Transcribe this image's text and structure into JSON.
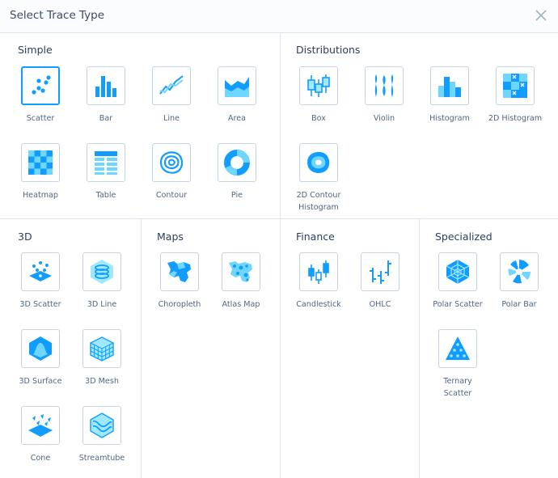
{
  "header": {
    "title": "Select Trace Type"
  },
  "sections": {
    "simple": {
      "title": "Simple",
      "items": [
        {
          "label": "Scatter"
        },
        {
          "label": "Bar"
        },
        {
          "label": "Line"
        },
        {
          "label": "Area"
        },
        {
          "label": "Heatmap"
        },
        {
          "label": "Table"
        },
        {
          "label": "Contour"
        },
        {
          "label": "Pie"
        }
      ]
    },
    "distributions": {
      "title": "Distributions",
      "items": [
        {
          "label": "Box"
        },
        {
          "label": "Violin"
        },
        {
          "label": "Histogram"
        },
        {
          "label": "2D Histogram"
        },
        {
          "label": "2D Contour Histogram"
        }
      ]
    },
    "threed": {
      "title": "3D",
      "items": [
        {
          "label": "3D Scatter"
        },
        {
          "label": "3D Line"
        },
        {
          "label": "3D Surface"
        },
        {
          "label": "3D Mesh"
        },
        {
          "label": "Cone"
        },
        {
          "label": "Streamtube"
        }
      ]
    },
    "maps": {
      "title": "Maps",
      "items": [
        {
          "label": "Choropleth"
        },
        {
          "label": "Atlas Map"
        }
      ]
    },
    "finance": {
      "title": "Finance",
      "items": [
        {
          "label": "Candlestick"
        },
        {
          "label": "OHLC"
        }
      ]
    },
    "specialized": {
      "title": "Specialized",
      "items": [
        {
          "label": "Polar Scatter"
        },
        {
          "label": "Polar Bar"
        },
        {
          "label": "Ternary Scatter"
        }
      ]
    }
  },
  "colors": {
    "accent": "#119dff",
    "light": "#9fe8ff",
    "text": "#2a3f5f",
    "border": "#c8d4e3"
  }
}
